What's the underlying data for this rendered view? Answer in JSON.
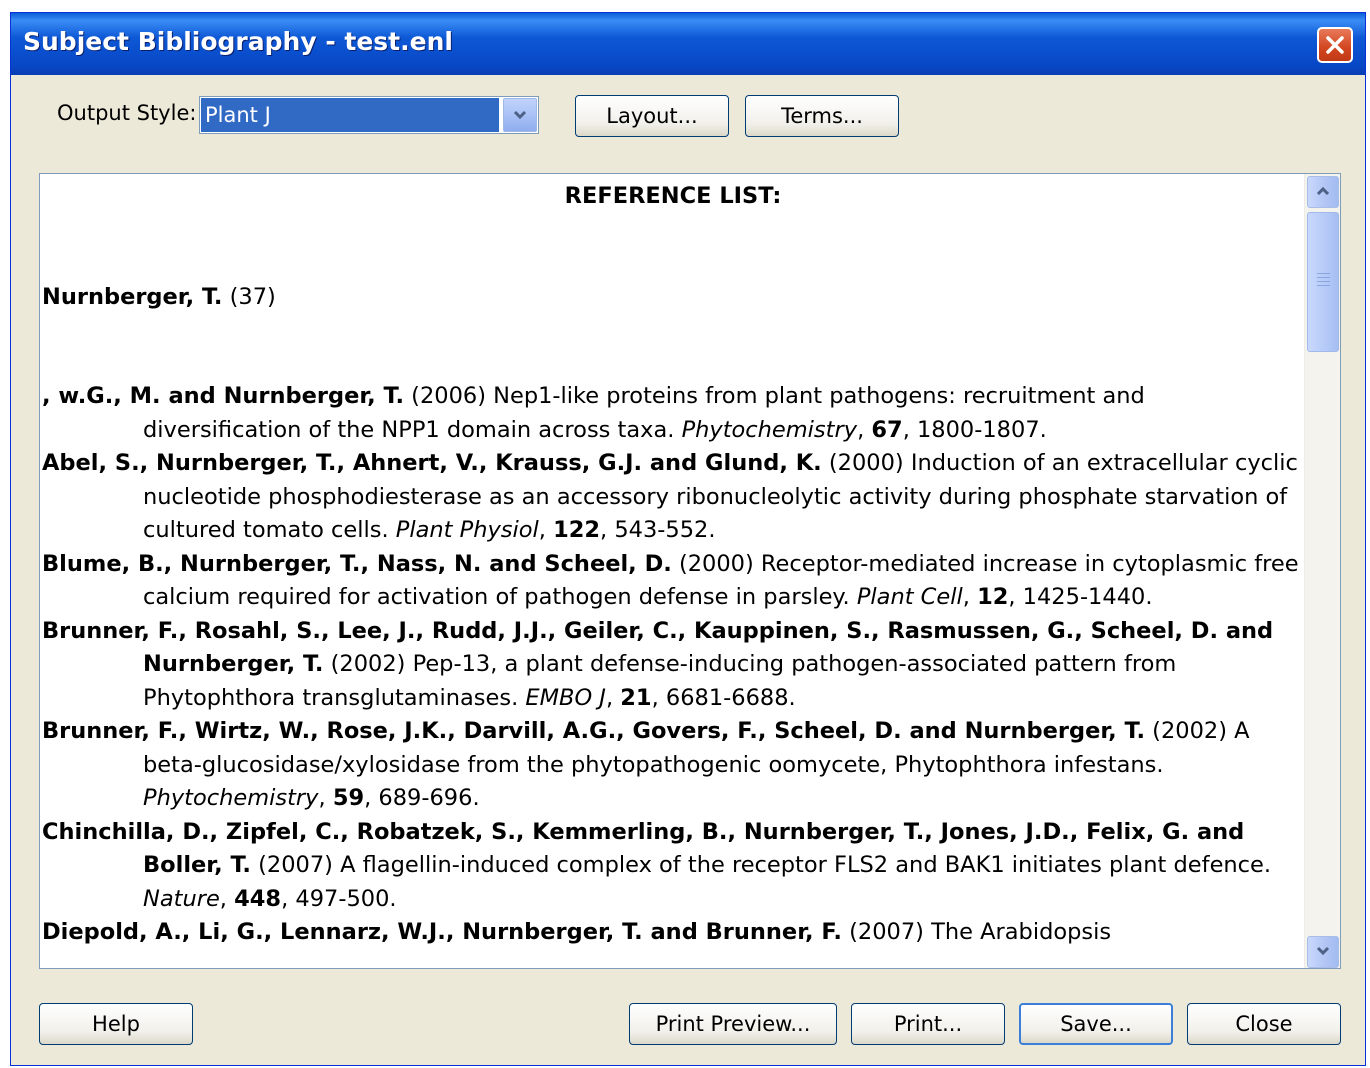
{
  "window": {
    "title": "Subject Bibliography - test.enl"
  },
  "toolbar": {
    "output_style_label": "Output Style:",
    "output_style_value": "Plant J",
    "layout_label": "Layout...",
    "terms_label": "Terms..."
  },
  "document": {
    "heading": "REFERENCE LIST:",
    "author": {
      "name": "Nurnberger, T.",
      "count": "(37)"
    },
    "references": [
      {
        "authors": ", w.G., M. and Nurnberger, T.",
        "rest": " (2006) Nep1-like proteins from plant pathogens: recruitment and diversification of the NPP1 domain across taxa. ",
        "journal": "Phytochemistry",
        "sep": ", ",
        "volume": "67",
        "pages": ", 1800-1807."
      },
      {
        "authors": "Abel, S., Nurnberger, T., Ahnert, V., Krauss, G.J. and Glund, K.",
        "rest": " (2000) Induction of an extracellular cyclic nucleotide phosphodiesterase as an accessory ribonucleolytic activity during phosphate starvation of cultured tomato cells. ",
        "journal": "Plant Physiol",
        "sep": ", ",
        "volume": "122",
        "pages": ", 543-552."
      },
      {
        "authors": "Blume, B., Nurnberger, T., Nass, N. and Scheel, D.",
        "rest": " (2000) Receptor-mediated increase in cytoplasmic free calcium required for activation of pathogen defense in parsley. ",
        "journal": "Plant Cell",
        "sep": ", ",
        "volume": "12",
        "pages": ", 1425-1440."
      },
      {
        "authors": "Brunner, F., Rosahl, S., Lee, J., Rudd, J.J., Geiler, C., Kauppinen, S., Rasmussen, G., Scheel, D. and Nurnberger, T.",
        "rest": " (2002) Pep-13, a plant defense-inducing pathogen-associated pattern from Phytophthora transglutaminases. ",
        "journal": "EMBO J",
        "sep": ", ",
        "volume": "21",
        "pages": ", 6681-6688."
      },
      {
        "authors": "Brunner, F., Wirtz, W., Rose, J.K., Darvill, A.G., Govers, F., Scheel, D. and Nurnberger, T.",
        "rest": " (2002) A beta-glucosidase/xylosidase from the phytopathogenic oomycete, Phytophthora infestans. ",
        "journal": "Phytochemistry",
        "sep": ", ",
        "volume": "59",
        "pages": ", 689-696."
      },
      {
        "authors": "Chinchilla, D., Zipfel, C., Robatzek, S., Kemmerling, B., Nurnberger, T., Jones, J.D., Felix, G. and Boller, T.",
        "rest": " (2007) A flagellin-induced complex of the receptor FLS2 and BAK1 initiates plant defence. ",
        "journal": "Nature",
        "sep": ", ",
        "volume": "448",
        "pages": ", 497-500."
      },
      {
        "authors": "Diepold, A., Li, G., Lennarz, W.J., Nurnberger, T. and Brunner, F.",
        "rest": " (2007) The Arabidopsis",
        "journal": "",
        "sep": "",
        "volume": "",
        "pages": ""
      }
    ]
  },
  "footer": {
    "help_label": "Help",
    "print_preview_label": "Print Preview...",
    "print_label": "Print...",
    "save_label": "Save...",
    "close_label": "Close"
  }
}
